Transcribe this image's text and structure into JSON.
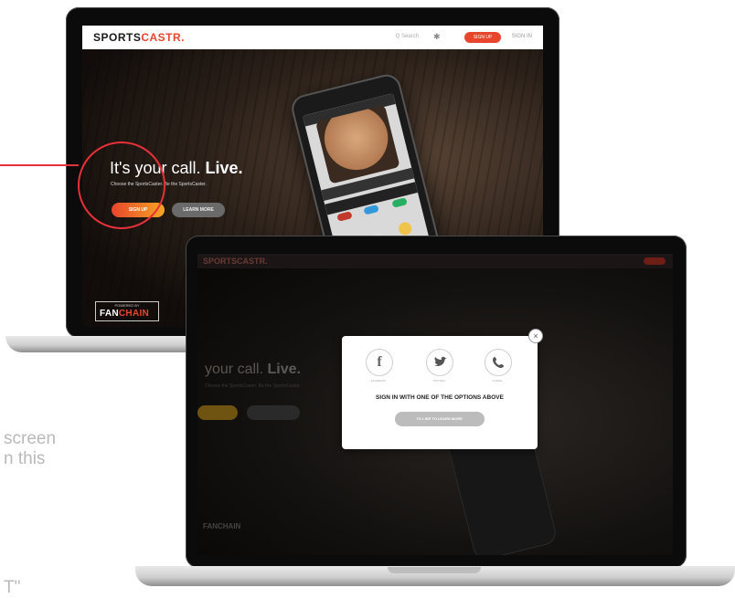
{
  "background_text": {
    "line1": "screen",
    "line2": "n this",
    "line3": "T\""
  },
  "back_site": {
    "logo_part1": "SPORTS",
    "logo_part2": "CASTR.",
    "nav_search": "Q Search",
    "nav_gift_icon": "gift-icon",
    "nav_pill": "SIGN UP",
    "nav_signin": "SIGN IN",
    "hero_title_prefix": "It's your call.",
    "hero_title_bold": "Live.",
    "hero_sub": "Choose the SportsCaster. Be the SportsCaster.",
    "signup_button": "SIGN UP",
    "learn_button": "LEARN MORE",
    "powered_by": "POWERED BY",
    "fanchain_part1": "FAN",
    "fanchain_part2": "CHAIN"
  },
  "front_site": {
    "logo": "SPORTSCASTR.",
    "hero_title_prefix": "your call.",
    "hero_title_bold": "Live.",
    "hero_sub": "Choose the SportsCaster. Be the SportsCaster.",
    "fanchain": "FANCHAIN",
    "modal": {
      "close_icon": "close-icon",
      "facebook_icon": "f",
      "facebook_label": "FACEBOOK",
      "twitter_icon": "twitter-bird",
      "twitter_label": "TWITTER",
      "phone_icon": "phone-icon",
      "phone_label": "PHONE",
      "heading": "SIGN IN WITH ONE OF THE OPTIONS ABOVE",
      "button": "I'D LIKE TO LEARN MORE"
    }
  },
  "colors": {
    "accent_red": "#e8452c",
    "highlight_circle": "#e8303a",
    "gradient_orange": "#f4a623"
  }
}
